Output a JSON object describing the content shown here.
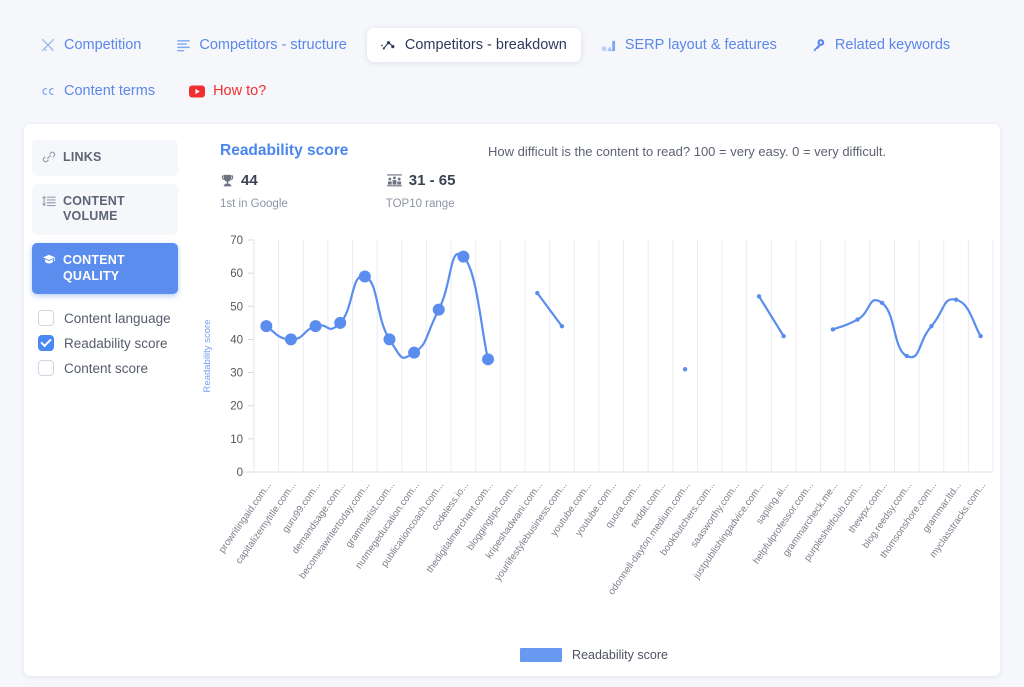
{
  "tabs": [
    {
      "label": "Competition",
      "icon": "competition-icon",
      "active": false
    },
    {
      "label": "Competitors - structure",
      "icon": "list-icon",
      "active": false
    },
    {
      "label": "Competitors - breakdown",
      "icon": "network-icon",
      "active": true
    },
    {
      "label": "SERP layout & features",
      "icon": "serp-layout-icon",
      "active": false
    },
    {
      "label": "Related keywords",
      "icon": "key-icon",
      "active": false
    },
    {
      "label": "Content terms",
      "icon": "quote-icon",
      "active": false
    },
    {
      "label": "How to?",
      "icon": "youtube-icon",
      "active": false
    }
  ],
  "sidebar": {
    "items": [
      {
        "label": "LINKS",
        "icon": "link-icon",
        "selected": false
      },
      {
        "label": "CONTENT VOLUME",
        "icon": "volume-icon",
        "selected": false
      },
      {
        "label": "CONTENT QUALITY",
        "icon": "quality-icon",
        "selected": true
      }
    ],
    "checkboxes": [
      {
        "label": "Content language",
        "checked": false
      },
      {
        "label": "Readability score",
        "checked": true
      },
      {
        "label": "Content score",
        "checked": false
      }
    ]
  },
  "main": {
    "title": "Readability score",
    "description": "How difficult is the content to read? 100 = very easy. 0 = very difficult.",
    "stats": [
      {
        "icon": "trophy-icon",
        "value": "44",
        "label": "1st in Google"
      },
      {
        "icon": "podium-icon",
        "value": "31 - 65",
        "label": "TOP10 range"
      }
    ]
  },
  "colors": {
    "accent": "#5b8def",
    "line": "#5b8def",
    "tab_text": "#5b87e8",
    "active_tab_text": "#2d3a5c",
    "page_bg": "#f5f7fb",
    "panel_bg": "#ffffff",
    "red": "#f03030"
  },
  "chart_data": {
    "type": "line",
    "title": "Readability score",
    "xlabel": "",
    "ylabel": "Readability score",
    "ylim": [
      0,
      70
    ],
    "yticks": [
      0,
      10,
      20,
      30,
      40,
      50,
      60,
      70
    ],
    "grid": true,
    "legend": [
      "Readability score"
    ],
    "legend_position": "bottom",
    "categories": [
      "prowritingaid.com...",
      "capitalizemytitle.com...",
      "guru99.com...",
      "demandsage.com...",
      "becomeawritertoday.com...",
      "grammarist.com...",
      "nutmegeducation.com...",
      "publicationcoach.com...",
      "codeless.io...",
      "thedigitalmerchant.com...",
      "bloggingtips.com...",
      "kripeshadwani.com...",
      "yourlifestylebusiness.com...",
      "youtube.com...",
      "youtube.com...",
      "quora.com...",
      "reddit.com...",
      "odonnell-dayton.medium.com...",
      "bookbutchers.com...",
      "saasworthy.com...",
      "justpublishingadvice.com...",
      "sapling.ai...",
      "helpfulprofessor.com...",
      "grammarcheck.me...",
      "purpleshelfclub.com...",
      "thewpx.com...",
      "blog.reedsy.com...",
      "thomsonshore.com...",
      "grammar.ltd...",
      "myclasstracks.com..."
    ],
    "series": [
      {
        "name": "Readability score",
        "values": [
          44,
          40,
          44,
          45,
          59,
          40,
          36,
          49,
          65,
          34,
          null,
          54,
          44,
          null,
          null,
          null,
          null,
          31,
          null,
          null,
          53,
          41,
          null,
          43,
          46,
          51,
          35,
          44,
          52,
          41
        ]
      }
    ],
    "marker_large_indices": [
      0,
      1,
      2,
      3,
      4,
      5,
      6,
      7,
      8,
      9
    ]
  }
}
